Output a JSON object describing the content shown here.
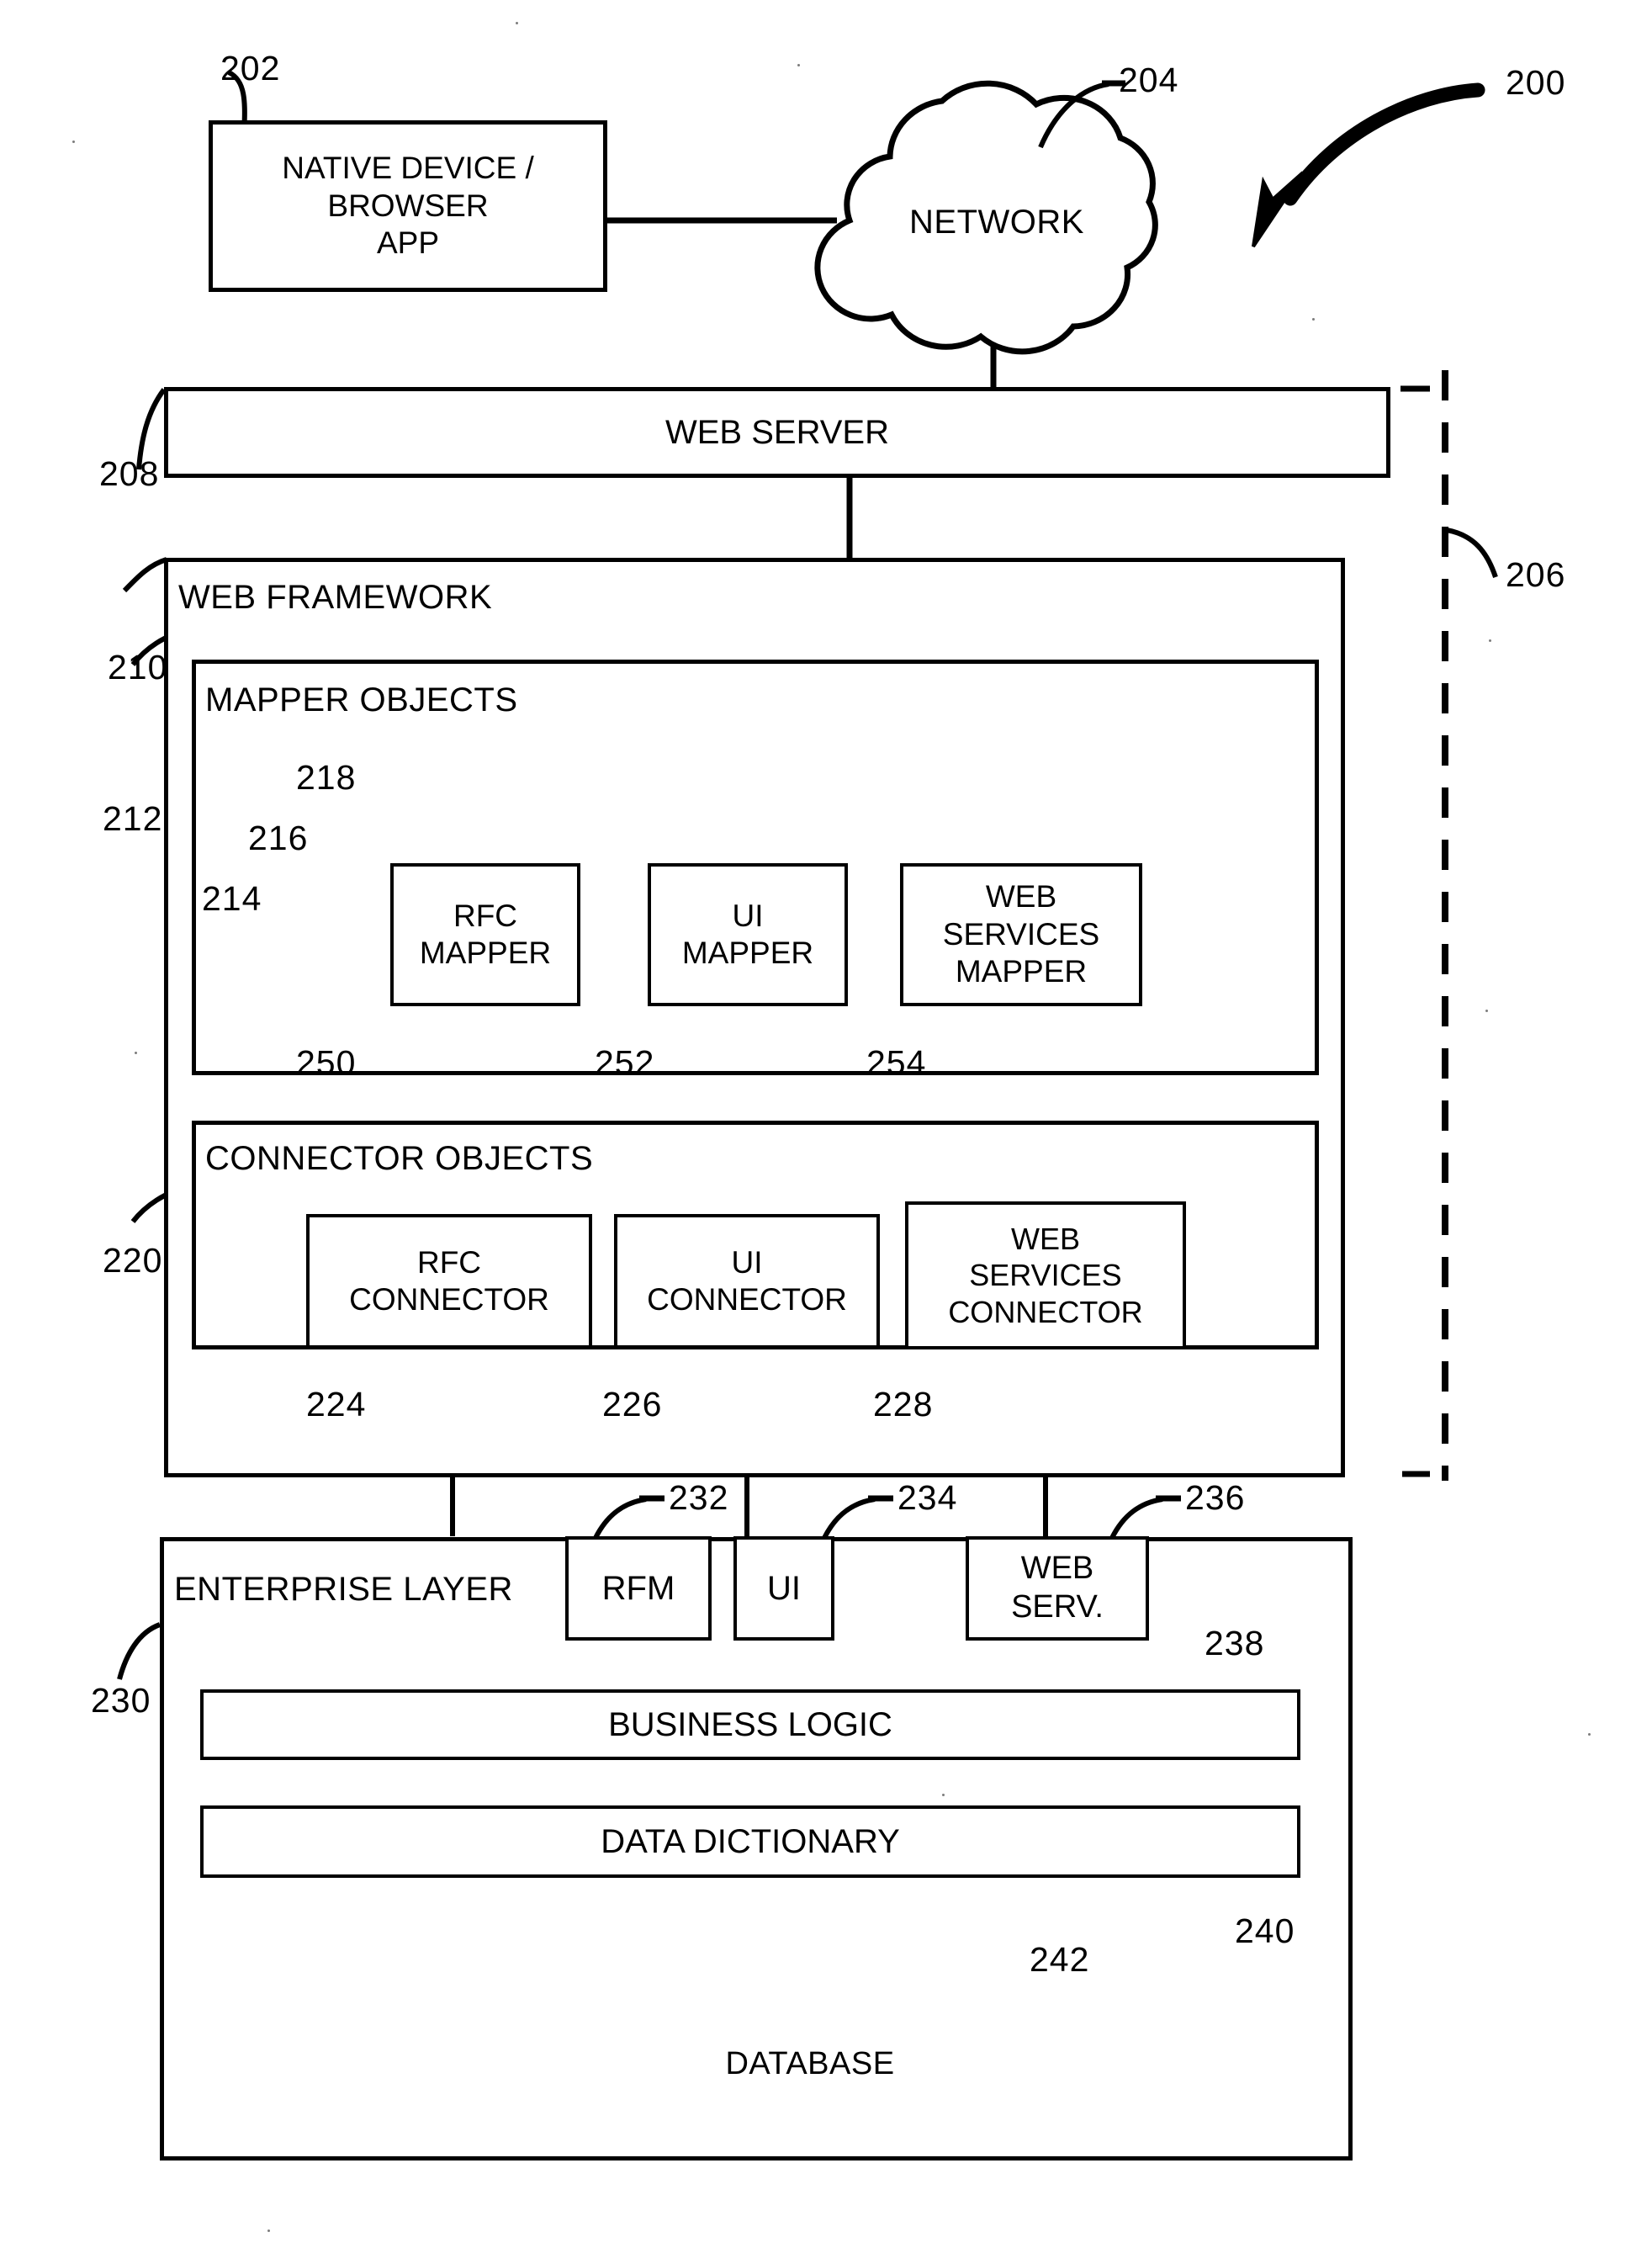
{
  "figure": {
    "ref_main": "200",
    "nodes": {
      "native_device": {
        "label": "NATIVE DEVICE /\nBROWSER\nAPP",
        "ref": "202"
      },
      "network": {
        "label": "NETWORK",
        "ref": "204"
      },
      "server_group": {
        "ref": "206"
      },
      "web_server": {
        "label": "WEB SERVER",
        "ref": "208"
      },
      "web_framework": {
        "label": "WEB FRAMEWORK",
        "ref": "210"
      },
      "mapper_objects": {
        "label": "MAPPER OBJECTS",
        "ref": "212"
      },
      "mapper_stack_front": {
        "ref": "214"
      },
      "mapper_stack_mid": {
        "ref": "216"
      },
      "mapper_stack_back": {
        "ref": "218"
      },
      "rfc_mapper": {
        "label": "RFC\nMAPPER",
        "ref": "250"
      },
      "ui_mapper": {
        "label": "UI\nMAPPER",
        "ref": "252"
      },
      "ws_mapper": {
        "label": "WEB\nSERVICES\nMAPPER",
        "ref": "254"
      },
      "connector_objects": {
        "label": "CONNECTOR OBJECTS",
        "ref": "220"
      },
      "rfc_connector": {
        "label": "RFC\nCONNECTOR",
        "ref": "224"
      },
      "ui_connector": {
        "label": "UI\nCONNECTOR",
        "ref": "226"
      },
      "ws_connector": {
        "label": "WEB\nSERVICES\nCONNECTOR",
        "ref": "228"
      },
      "enterprise_layer": {
        "label": "ENTERPRISE LAYER",
        "ref": "230"
      },
      "rfm": {
        "label": "RFM",
        "ref": "232"
      },
      "ui": {
        "label": "UI",
        "ref": "234"
      },
      "web_serv": {
        "label": "WEB\nSERV.",
        "ref": "236"
      },
      "business_logic": {
        "label": "BUSINESS LOGIC",
        "ref": "238"
      },
      "data_dictionary": {
        "label": "DATA DICTIONARY",
        "ref": "240"
      },
      "database": {
        "label": "DATABASE",
        "ref": "242"
      }
    }
  },
  "colors": {
    "ink": "#000000",
    "paper": "#ffffff"
  }
}
